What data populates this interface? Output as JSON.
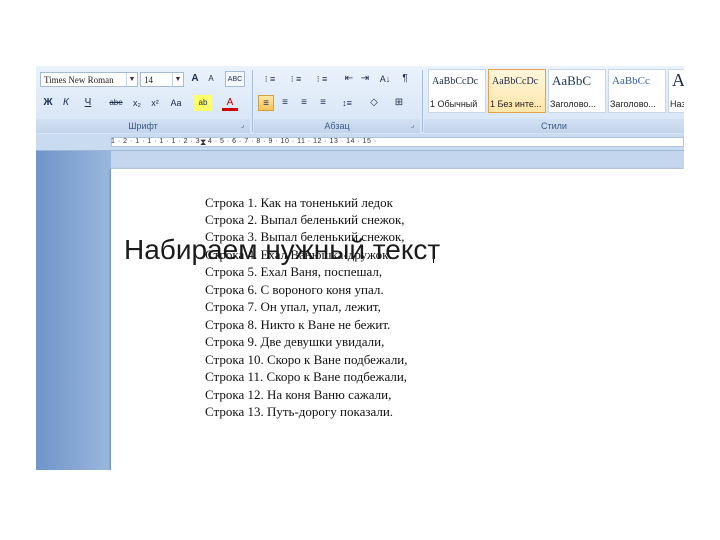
{
  "slide_title": "Набираем нужный текст",
  "ribbon": {
    "font_name": "Times New Roman",
    "font_size": "14",
    "groups": {
      "font": "Шрифт",
      "paragraph": "Абзац",
      "styles": "Стили"
    },
    "buttons": {
      "grow": "A",
      "shrink": "A",
      "clear_format": "ABC",
      "bold": "Ж",
      "italic": "К",
      "underline": "Ч",
      "strike": "abe",
      "subscript": "x₂",
      "superscript": "x²",
      "change_case": "Aa",
      "highlight": "ab",
      "font_color": "A",
      "bullets": "⁝ ≡",
      "numbering": "⁝ ≡",
      "multilevel": "⁝ ≡",
      "decrease_indent": "⇤",
      "increase_indent": "⇥",
      "sort": "A↓",
      "pilcrow": "¶",
      "align_left": "≡",
      "align_center": "≡",
      "align_right": "≡",
      "justify": "≡",
      "line_spacing": "↕≡",
      "shading": "◇",
      "borders": "⊞"
    },
    "styles": [
      {
        "sample": "AaBbCcDc",
        "name": "1 Обычный",
        "selected": false
      },
      {
        "sample": "AaBbCcDc",
        "name": "1 Без инте...",
        "selected": true
      },
      {
        "sample": "AaBbC",
        "name": "Заголово...",
        "selected": false
      },
      {
        "sample": "AaBbCc",
        "name": "Заголово...",
        "selected": false
      },
      {
        "sample": "A",
        "name": "Наз",
        "selected": false
      }
    ]
  },
  "ruler": {
    "numbers": "1 · 2 · 1 · 1 · 1 · 1 · 2 · 3 · 4 · 5 · 6 · 7 · 8 · 9 · 10 · 11 · 12 · 13 · 14 · 15 ·"
  },
  "document": {
    "lines": [
      "Строка 1. Как на тоненький ледок",
      "Строка 2. Выпал беленький снежок,",
      "Строка 3. Выпал беленький снежок,",
      "Строка 4. Ехал Ванюшка-дружок.",
      "Строка 5. Ехал Ваня, поспешал,",
      "Строка 6. С вороного коня упал.",
      "Строка 7. Он упал, упал, лежит,",
      "Строка 8. Никто к Ване не бежит.",
      "Строка 9. Две девушки увидали,",
      "Строка 10. Скоро к Ване подбежали,",
      "Строка 11. Скоро к Ване подбежали,",
      "Строка 12. На коня Ваню сажали,",
      "Строка 13. Путь-дорогу показали."
    ]
  }
}
